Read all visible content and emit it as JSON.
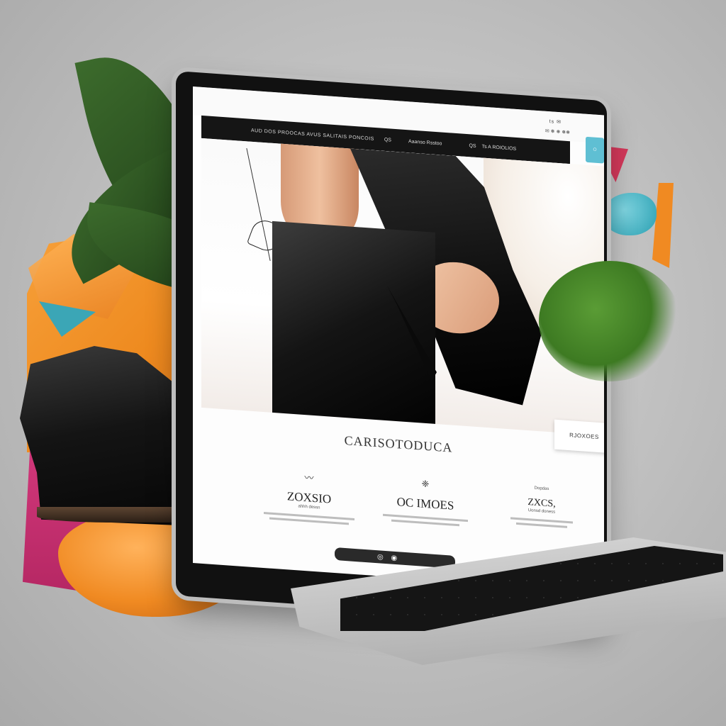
{
  "site": {
    "top_links": "ts ✉",
    "top_sub": "✉ ❅ ❅ ❅❅",
    "nav": {
      "left": "AUD DOS PROOCAS AVUS SALITAIS PONCOIS",
      "mid": "QS",
      "links": "Aaanso Rsstoo",
      "right_a": "QS",
      "right_b": "Ts A ROIOLIOS",
      "cyan_icon": "○"
    },
    "badge_text": "RJOXOES",
    "brand_title": "CARISOTODUCA",
    "columns": [
      {
        "icon": "〰",
        "title": "ZOXSIO",
        "sub": "ahhh dessn"
      },
      {
        "icon": "❈",
        "title": "OC IMOES",
        "sub": ""
      },
      {
        "icon": "Dopdas",
        "title": "ZXCS,",
        "sub": "Uonsd doness"
      }
    ],
    "dock_icons": "◎ ◉"
  },
  "colors": {
    "accent_orange": "#f08a22",
    "accent_pink": "#d63a7e",
    "accent_teal": "#3ba6b6",
    "nav_bg": "#151515"
  }
}
